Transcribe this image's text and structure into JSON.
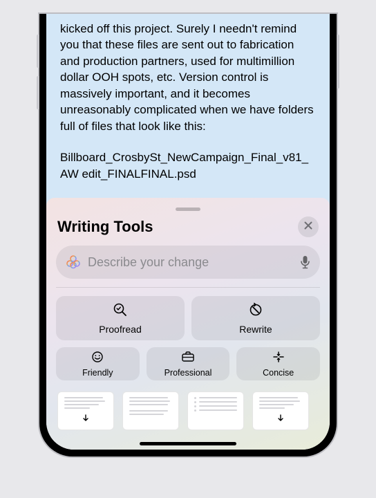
{
  "content": {
    "paragraph": "kicked off this project. Surely I needn't remind you that these files are sent out to fabrication and production partners, used for multimillion dollar OOH spots, etc. Version control is massively important, and it becomes unreasonably complicated when we have folders full of files that look like this:",
    "filename": "Billboard_CrosbySt_NewCampaign_Final_v81_AW edit_FINALFINAL.psd"
  },
  "sheet": {
    "title": "Writing Tools",
    "input_placeholder": "Describe your change",
    "actions": {
      "proofread": "Proofread",
      "rewrite": "Rewrite",
      "friendly": "Friendly",
      "professional": "Professional",
      "concise": "Concise"
    }
  }
}
